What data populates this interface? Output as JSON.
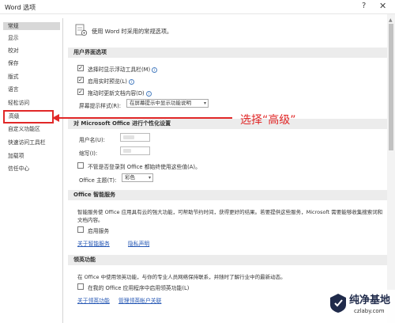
{
  "window": {
    "title": "Word 选项",
    "help": "?",
    "close": "✕"
  },
  "sidebar": {
    "items": [
      {
        "label": "常规",
        "state": "selected"
      },
      {
        "label": "显示"
      },
      {
        "label": "校对"
      },
      {
        "label": "保存"
      },
      {
        "label": "版式"
      },
      {
        "label": "语言"
      },
      {
        "label": "轻松访问"
      },
      {
        "label": "高级",
        "state": "highlighted"
      },
      {
        "label": "自定义功能区"
      },
      {
        "label": "快速访问工具栏"
      },
      {
        "label": "加载项"
      },
      {
        "label": "信任中心"
      }
    ]
  },
  "main": {
    "intro": "使用 Word 时采用的常规选项。",
    "ui_options": {
      "header": "用户界面选项",
      "show_mini_toolbar": "选择时显示浮动工具栏(M)",
      "live_preview": "启用实时预览(L)",
      "update_while_dragging": "拖动时更新文档内容(D)",
      "screentip_label": "屏幕提示样式(R):",
      "screentip_value": "在屏幕提示中显示功能说明"
    },
    "personalize": {
      "header": "对 Microsoft Office 进行个性化设置",
      "username_label": "用户名(U):",
      "initials_label": "缩写(I):",
      "always_use": "不管是否登录到 Office 都始终使用这些值(A)。",
      "theme_label": "Office 主题(T):",
      "theme_value": "彩色"
    },
    "intelligent": {
      "header": "Office 智能服务",
      "description": "智能服务使 Office 应用具有云的强大功能，可帮助节约时间，获得更好的结果。若要提供这些服务，Microsoft 需要能够收集搜索词和文档内容。",
      "enable": "启用服务",
      "about_link": "关于智能服务",
      "privacy_link": "隐私声明"
    },
    "linkedin": {
      "header": "领英功能",
      "description": "在 Office 中使用领英功能，与你的专业人员网络保持联系，并随时了解行业中的最新动态。",
      "enable": "在我的 Office 应用程序中启用领英功能(L)",
      "about_link": "关于领英功能",
      "manage_link": "管理领英帐户关联"
    }
  },
  "annotation": {
    "text": "选择“高级”"
  },
  "watermark": {
    "line1": "纯净基地",
    "line2": "czlaby.com"
  }
}
